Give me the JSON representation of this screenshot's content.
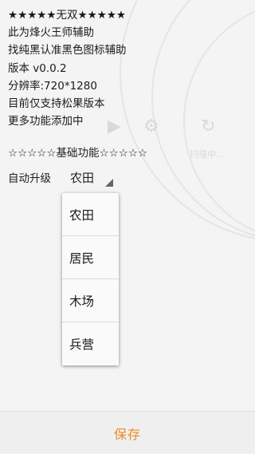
{
  "header_lines": [
    "★★★★★无双★★★★★",
    "此为烽火王师辅助",
    "找纯黑认准黑色图标辅助",
    "版本 v0.0.2",
    "分辨率:720*1280",
    "目前仅支持松果版本",
    "更多功能添加中"
  ],
  "section_title": "☆☆☆☆☆基础功能☆☆☆☆☆",
  "auto_upgrade": {
    "label": "自动升级",
    "selected": "农田",
    "options": [
      "农田",
      "居民",
      "木场",
      "兵营"
    ]
  },
  "background": {
    "icon_names": [
      "play-icon",
      "gear-icon",
      "refresh-icon"
    ],
    "label_faded": "扫描中..."
  },
  "footer": {
    "save_label": "保存",
    "accent_color": "#f08a24"
  }
}
